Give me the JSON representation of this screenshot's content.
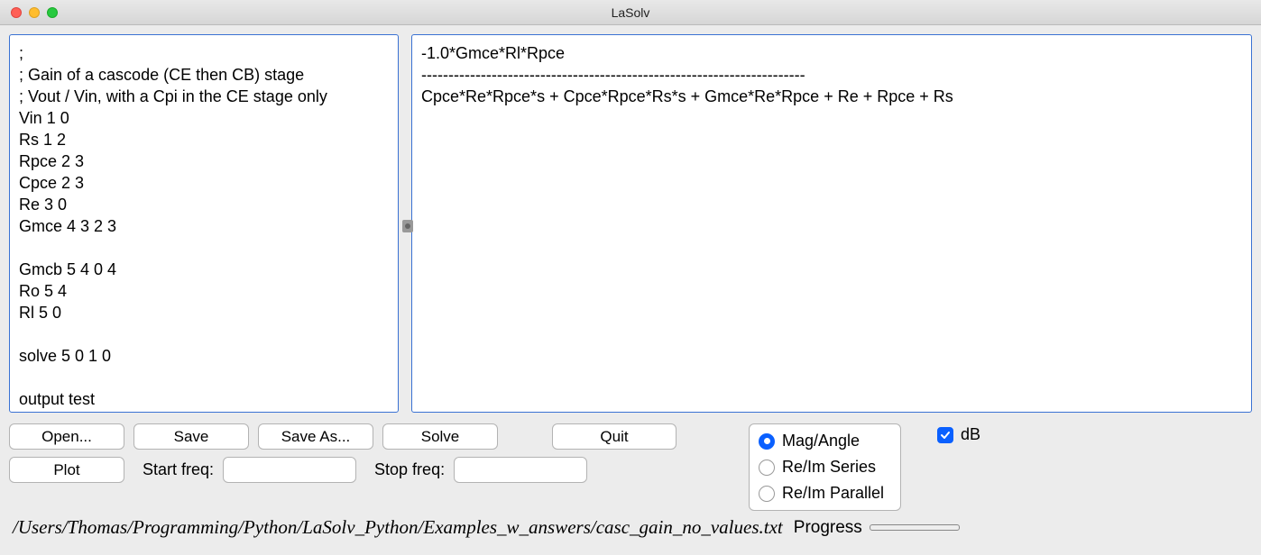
{
  "window": {
    "title": "LaSolv"
  },
  "editor": {
    "input_text": ";\n; Gain of a cascode (CE then CB) stage\n; Vout / Vin, with a Cpi in the CE stage only\nVin 1 0\nRs 1 2\nRpce 2 3\nCpce 2 3\nRe 3 0\nGmce 4 3 2 3\n\nGmcb 5 4 0 4\nRo 5 4\nRl 5 0\n\nsolve 5 0 1 0\n\noutput test",
    "output_text": "-1.0*Gmce*Rl*Rpce\n-----------------------------------------------------------------------\nCpce*Re*Rpce*s + Cpce*Rpce*Rs*s + Gmce*Re*Rpce + Re + Rpce + Rs"
  },
  "buttons": {
    "open": "Open...",
    "save": "Save",
    "save_as": "Save As...",
    "solve": "Solve",
    "quit": "Quit",
    "plot": "Plot"
  },
  "freq": {
    "start_label": "Start freq:",
    "start_value": "",
    "stop_label": "Stop freq:",
    "stop_value": ""
  },
  "radios": {
    "mag_angle": "Mag/Angle",
    "reim_series": "Re/Im Series",
    "reim_parallel": "Re/Im Parallel",
    "selected": "mag_angle"
  },
  "checkbox": {
    "db_label": "dB",
    "db_checked": true
  },
  "status": {
    "path": "/Users/Thomas/Programming/Python/LaSolv_Python/Examples_w_answers/casc_gain_no_values.txt",
    "progress_label": "Progress"
  }
}
